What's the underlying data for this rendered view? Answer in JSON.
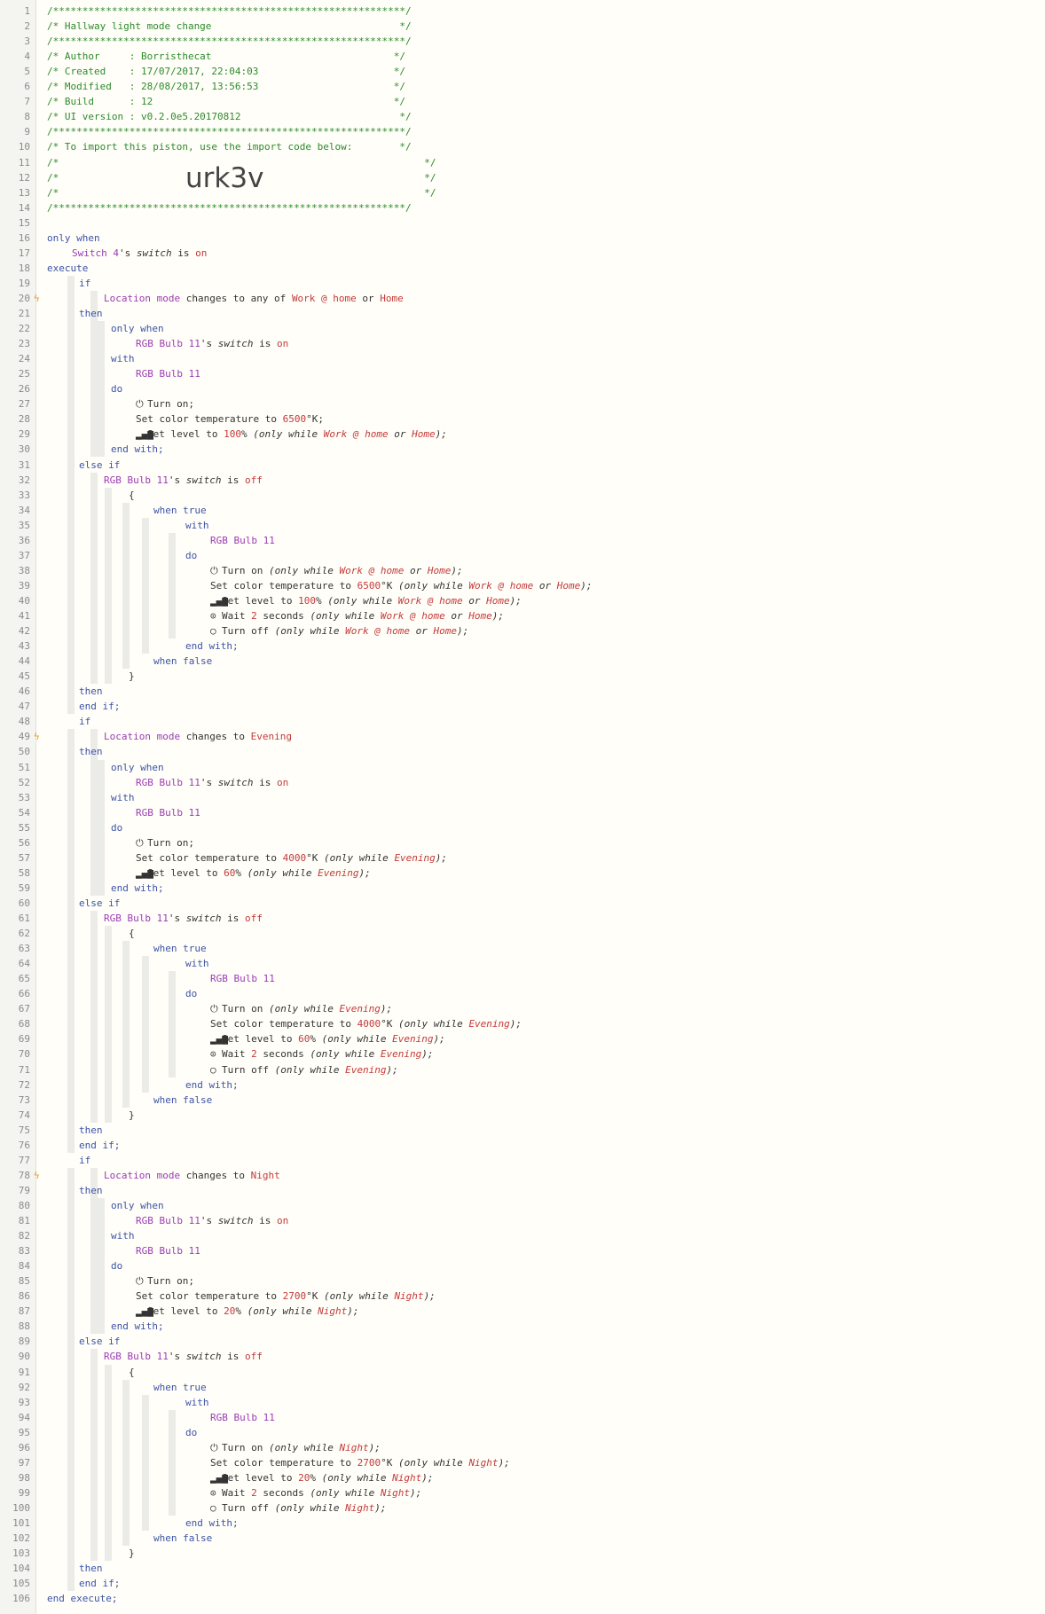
{
  "header": {
    "stars": "/************************************************************/",
    "title_line": "/* Hallway light mode change                                */",
    "author_line": "/* Author     : Borristhecat                               */",
    "created_line": "/* Created    : 17/07/2017, 22:04:03                       */",
    "modified_line": "/* Modified   : 28/08/2017, 13:56:53                       */",
    "build_line": "/* Build      : 12                                         */",
    "ui_version_line": "/* UI version : v0.2.0e5.20170812                           */",
    "import_line": "/* To import this piston, use the import code below:        */",
    "blank_open": "/*",
    "blank_close": "*/",
    "import_code": "urk3v"
  },
  "kw": {
    "only_when": "only when",
    "execute": "execute",
    "if": "if",
    "then": "then",
    "with": "with",
    "do": "do",
    "end_with": "end with;",
    "else_if": "else if",
    "brace_open": "{",
    "brace_close": "}",
    "when_true": "when true",
    "when_false": "when false",
    "end_if": "end if;",
    "end_execute": "end execute;"
  },
  "devices": {
    "switch4": "Switch 4",
    "bulb": "RGB Bulb 11",
    "location_mode": "Location mode"
  },
  "text": {
    "apos": "'s",
    "attr_switch": "switch",
    "is": "is",
    "on": "on",
    "off": "off",
    "changes_to_any_of": "changes to any of",
    "changes_to": "changes to",
    "or": "or",
    "turn_on": "Turn on",
    "turn_off": "Turn off",
    "set_color_temperature_to": "Set color temperature to",
    "set_level_to": "Set level to",
    "wait": "Wait",
    "seconds": "seconds",
    "kelvin": "°K",
    "semicolon": ";",
    "only_while_open": "(only while",
    "close_paren_semicolon": ");",
    "percent": "%"
  },
  "modes": {
    "work_at_home": "Work @ home",
    "home": "Home",
    "evening": "Evening",
    "night": "Night"
  },
  "values": {
    "temp_6500": "6500",
    "temp_4000": "4000",
    "temp_2700": "2700",
    "level_100": "100",
    "level_60": "60",
    "level_20": "20",
    "wait_2": "2"
  },
  "icons": {
    "power": "⏻",
    "signal": "▂▄▆",
    "clock": "⊙",
    "circle": "○",
    "bolt": "ϟ"
  },
  "colors": {
    "keyword": "#3c53a8",
    "device": "#9b3cb5",
    "value": "#c43a3a",
    "comment": "#2c8b2c",
    "bolt": "#e69a2e"
  }
}
